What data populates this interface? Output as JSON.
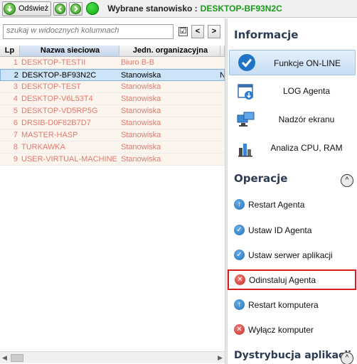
{
  "toolbar": {
    "refresh_label": "Odśwież",
    "selected_label": "Wybrane stanowisko :",
    "selected_value": "DESKTOP-BF93N2C"
  },
  "search": {
    "placeholder": "szukaj w widocznych kolumnach",
    "checkbox_mark": "☑",
    "prev_label": "<",
    "next_label": ">"
  },
  "grid": {
    "columns": [
      "Lp",
      "Nazwa sieciowa",
      "Jedn. organizacyjna"
    ],
    "rows": [
      {
        "lp": "1",
        "name": "DESKTOP-TESTII",
        "unit": "Biuro B-B",
        "extra": ""
      },
      {
        "lp": "2",
        "name": "DESKTOP-BF93N2C",
        "unit": "Stanowiska",
        "extra": "N"
      },
      {
        "lp": "3",
        "name": "DESKTOP-TEST",
        "unit": "Stanowiska",
        "extra": ""
      },
      {
        "lp": "4",
        "name": "DESKTOP-V6L53T4",
        "unit": "Stanowiska",
        "extra": ""
      },
      {
        "lp": "5",
        "name": "DESKTOP-VD5RP5G",
        "unit": "Stanowiska",
        "extra": ""
      },
      {
        "lp": "6",
        "name": "DRSIB-D0F82B7D7",
        "unit": "Stanowiska",
        "extra": ""
      },
      {
        "lp": "7",
        "name": "MASTER-HASP",
        "unit": "Stanowiska",
        "extra": ""
      },
      {
        "lp": "8",
        "name": "TURKAWKA",
        "unit": "Stanowiska",
        "extra": ""
      },
      {
        "lp": "9",
        "name": "USER-VIRTUAL-MACHINE",
        "unit": "Stanowiska",
        "extra": ""
      }
    ]
  },
  "panel": {
    "info_title": "Informacje",
    "functions": [
      {
        "label": "Funkcje ON-LINE",
        "icon": "check-circle-icon"
      },
      {
        "label": "LOG Agenta",
        "icon": "log-window-icon"
      },
      {
        "label": "Nadzór ekranu",
        "icon": "monitor-icon"
      },
      {
        "label": "Analiza CPU, RAM",
        "icon": "bar-chart-icon"
      }
    ],
    "operations_title": "Operacje",
    "collapse_symbol": "^",
    "operations": [
      {
        "label": "Restart Agenta",
        "icon": "arrow-up-circle-icon"
      },
      {
        "label": "Ustaw ID Agenta",
        "icon": "check-circle-icon"
      },
      {
        "label": "Ustaw serwer aplikacji",
        "icon": "check-circle-icon"
      },
      {
        "label": "Odinstaluj Agenta",
        "icon": "x-circle-icon"
      },
      {
        "label": "Restart komputera",
        "icon": "arrow-up-circle-icon"
      },
      {
        "label": "Wyłącz komputer",
        "icon": "x-circle-icon"
      }
    ],
    "distribution_title": "Dystrybucja aplikacji"
  },
  "colors": {
    "selected_station": "#1a9a1a",
    "row_text": "#e3786d",
    "highlight_border": "#d42020"
  }
}
